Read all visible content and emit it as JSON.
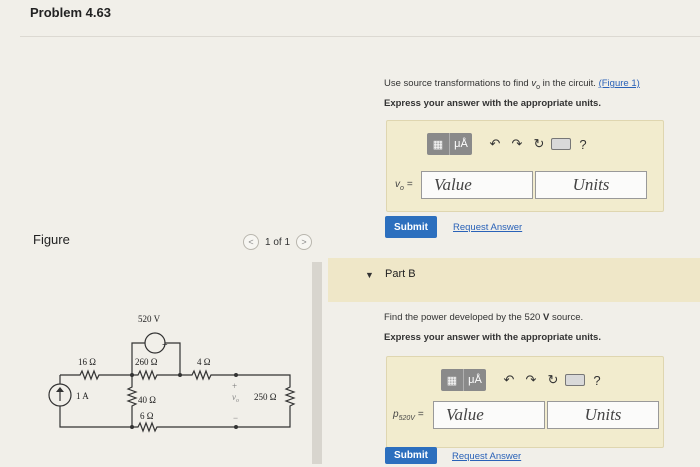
{
  "header": {
    "title": "Problem 4.63"
  },
  "figure": {
    "label": "Figure",
    "pager": {
      "prev": "<",
      "text": "1 of 1",
      "next": ">"
    },
    "circuit": {
      "src_v": "520 V",
      "r16": "16 Ω",
      "r260": "260 Ω",
      "r4": "4 Ω",
      "isrc": "1 A",
      "r40": "40 Ω",
      "r6": "6 Ω",
      "vo": "v",
      "vo_sub": "o",
      "r250": "250 Ω",
      "plus": "+",
      "minus": "−"
    }
  },
  "part_a": {
    "intro_pre": "Use source transformations to find ",
    "intro_var": "v",
    "intro_sub": "o",
    "intro_mid": " in the circuit.",
    "figure_link": "(Figure 1)",
    "express": "Express your answer with the appropriate units.",
    "toolbar": {
      "units_btn": "μÅ",
      "undo": "↶",
      "redo": "↷",
      "reset": "↻",
      "help": "?"
    },
    "var_label": "v",
    "var_sub": "o",
    "eq": "=",
    "value_placeholder": "Value",
    "units_placeholder": "Units",
    "submit": "Submit",
    "request": "Request Answer"
  },
  "part_b": {
    "arrow": "▼",
    "title": "Part B",
    "find_pre": "Find the power developed by the 520 ",
    "find_unit": "V",
    "find_post": " source.",
    "express": "Express your answer with the appropriate units.",
    "toolbar": {
      "units_btn": "μÅ",
      "undo": "↶",
      "redo": "↷",
      "reset": "↻",
      "help": "?"
    },
    "var_label": "p",
    "var_sub": "520V",
    "eq": "=",
    "value_placeholder": "Value",
    "units_placeholder": "Units",
    "submit": "Submit",
    "request": "Request Answer"
  },
  "colors": {
    "accent": "#2c6fbe",
    "answer_bg": "#f2ecce",
    "partb_band": "#efe7c8"
  }
}
